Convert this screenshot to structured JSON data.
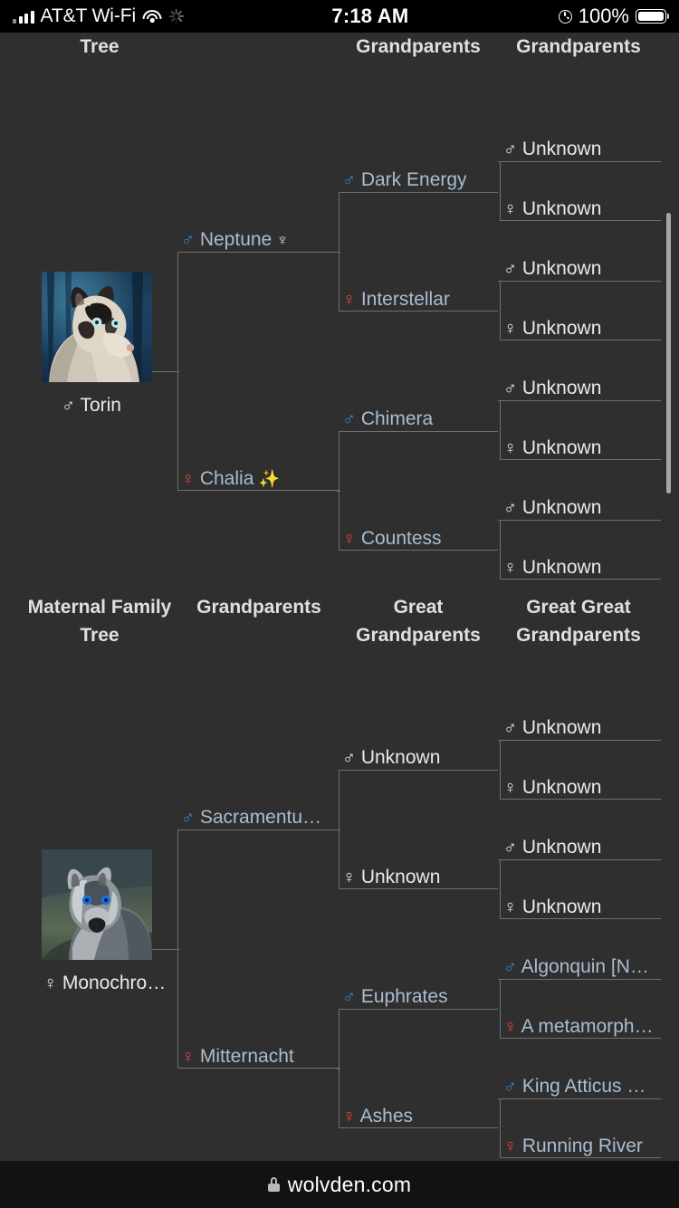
{
  "statusbar": {
    "carrier": "AT&T Wi-Fi",
    "time": "7:18 AM",
    "battery_pct": "100%",
    "signal_icon": "cellular-bars-icon",
    "wifi_icon": "wifi-icon",
    "activity_icon": "activity-spinner-icon",
    "orientation_lock_icon": "orientation-lock-icon",
    "battery_icon": "battery-full-icon"
  },
  "browser": {
    "lock_icon": "lock-icon",
    "url": "wolvden.com"
  },
  "paternal": {
    "headers": [
      {
        "label": "Tree",
        "name": "header-paternal-family-tree"
      },
      {
        "label": "Grandparents",
        "name": "header-great-grandparents"
      },
      {
        "label": "Grandparents",
        "name": "header-great-great-grandparents"
      }
    ],
    "subject": {
      "name": "Torin",
      "sex": "male",
      "symbol": "♂",
      "portrait_alt": "wolf-portrait-torin"
    },
    "parents": [
      {
        "name": "Neptune",
        "sex": "male",
        "symbol": "♂",
        "badge": "♆",
        "badge_name": "neptune-trident-icon",
        "link": true
      },
      {
        "name": "Chalia",
        "sex": "female",
        "symbol": "♀",
        "badge": "✨",
        "badge_name": "sparkles-icon",
        "link": true
      }
    ],
    "grandparents": [
      {
        "name": "Dark Energy",
        "sex": "male",
        "symbol": "♂",
        "link": true
      },
      {
        "name": "Interstellar",
        "sex": "female",
        "symbol": "♀",
        "link": true
      },
      {
        "name": "Chimera",
        "sex": "male",
        "symbol": "♂",
        "link": true
      },
      {
        "name": "Countess",
        "sex": "female",
        "symbol": "♀",
        "link": true
      }
    ],
    "great_grandparents": [
      {
        "name": "Unknown",
        "sex": "male",
        "symbol": "♂",
        "link": false
      },
      {
        "name": "Unknown",
        "sex": "female",
        "symbol": "♀",
        "link": false
      },
      {
        "name": "Unknown",
        "sex": "male",
        "symbol": "♂",
        "link": false
      },
      {
        "name": "Unknown",
        "sex": "female",
        "symbol": "♀",
        "link": false
      },
      {
        "name": "Unknown",
        "sex": "male",
        "symbol": "♂",
        "link": false
      },
      {
        "name": "Unknown",
        "sex": "female",
        "symbol": "♀",
        "link": false
      },
      {
        "name": "Unknown",
        "sex": "male",
        "symbol": "♂",
        "link": false
      },
      {
        "name": "Unknown",
        "sex": "female",
        "symbol": "♀",
        "link": false
      }
    ]
  },
  "maternal": {
    "headers": [
      {
        "label": "Maternal Family Tree",
        "name": "header-maternal-family-tree"
      },
      {
        "label": "Grandparents",
        "name": "header-grandparents"
      },
      {
        "label": "Great Grandparents",
        "name": "header-great-grandparents"
      },
      {
        "label": "Great Great Grandparents",
        "name": "header-great-great-grandparents"
      }
    ],
    "subject": {
      "name": "Monochro…",
      "sex": "female",
      "symbol": "♀",
      "portrait_alt": "wolf-portrait-monochrome"
    },
    "parents": [
      {
        "name": "Sacramentu…",
        "sex": "male",
        "symbol": "♂",
        "link": true
      },
      {
        "name": "Mitternacht",
        "sex": "female",
        "symbol": "♀",
        "link": true
      }
    ],
    "grandparents": [
      {
        "name": "Unknown",
        "sex": "male",
        "symbol": "♂",
        "link": false
      },
      {
        "name": "Unknown",
        "sex": "female",
        "symbol": "♀",
        "link": false
      },
      {
        "name": "Euphrates",
        "sex": "male",
        "symbol": "♂",
        "link": true
      },
      {
        "name": "Ashes",
        "sex": "female",
        "symbol": "♀",
        "link": true
      }
    ],
    "great_grandparents": [
      {
        "name": "Unknown",
        "sex": "male",
        "symbol": "♂",
        "link": false
      },
      {
        "name": "Unknown",
        "sex": "female",
        "symbol": "♀",
        "link": false
      },
      {
        "name": "Unknown",
        "sex": "male",
        "symbol": "♂",
        "link": false
      },
      {
        "name": "Unknown",
        "sex": "female",
        "symbol": "♀",
        "link": false
      },
      {
        "name": "Algonquin [N…",
        "sex": "male",
        "symbol": "♂",
        "link": true
      },
      {
        "name": "A metamorph…",
        "sex": "female",
        "symbol": "♀",
        "link": true
      },
      {
        "name": "King Atticus …",
        "sex": "male",
        "symbol": "♂",
        "link": true
      },
      {
        "name": "Running River",
        "sex": "female",
        "symbol": "♀",
        "link": true
      }
    ]
  },
  "colors": {
    "background": "#2f2f2f",
    "male": "#3d86c6",
    "female": "#e8453c",
    "link_text": "#a9bdd1",
    "unknown_text": "#eaeaea",
    "line": "#6e6e6e",
    "header_text": "#e0e0e0",
    "scrollbar": "#a5a5a5"
  }
}
